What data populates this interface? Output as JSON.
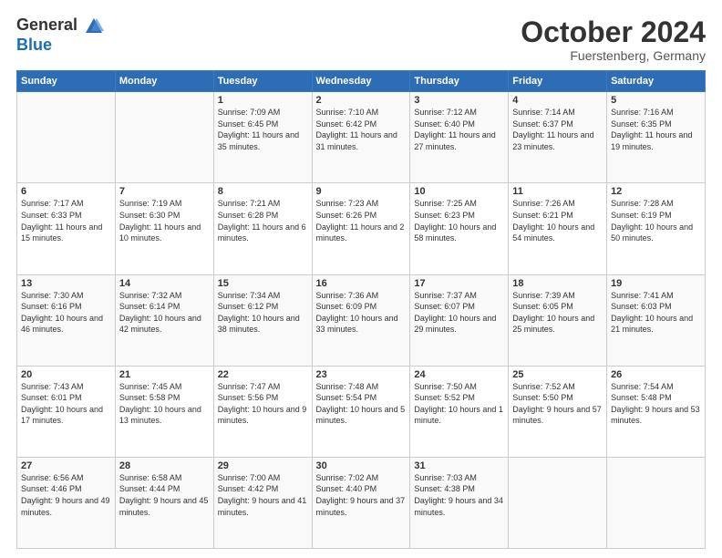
{
  "logo": {
    "general": "General",
    "blue": "Blue"
  },
  "header": {
    "title": "October 2024",
    "subtitle": "Fuerstenberg, Germany"
  },
  "weekdays": [
    "Sunday",
    "Monday",
    "Tuesday",
    "Wednesday",
    "Thursday",
    "Friday",
    "Saturday"
  ],
  "weeks": [
    [
      {
        "day": "",
        "sunrise": "",
        "sunset": "",
        "daylight": ""
      },
      {
        "day": "",
        "sunrise": "",
        "sunset": "",
        "daylight": ""
      },
      {
        "day": "1",
        "sunrise": "Sunrise: 7:09 AM",
        "sunset": "Sunset: 6:45 PM",
        "daylight": "Daylight: 11 hours and 35 minutes."
      },
      {
        "day": "2",
        "sunrise": "Sunrise: 7:10 AM",
        "sunset": "Sunset: 6:42 PM",
        "daylight": "Daylight: 11 hours and 31 minutes."
      },
      {
        "day": "3",
        "sunrise": "Sunrise: 7:12 AM",
        "sunset": "Sunset: 6:40 PM",
        "daylight": "Daylight: 11 hours and 27 minutes."
      },
      {
        "day": "4",
        "sunrise": "Sunrise: 7:14 AM",
        "sunset": "Sunset: 6:37 PM",
        "daylight": "Daylight: 11 hours and 23 minutes."
      },
      {
        "day": "5",
        "sunrise": "Sunrise: 7:16 AM",
        "sunset": "Sunset: 6:35 PM",
        "daylight": "Daylight: 11 hours and 19 minutes."
      }
    ],
    [
      {
        "day": "6",
        "sunrise": "Sunrise: 7:17 AM",
        "sunset": "Sunset: 6:33 PM",
        "daylight": "Daylight: 11 hours and 15 minutes."
      },
      {
        "day": "7",
        "sunrise": "Sunrise: 7:19 AM",
        "sunset": "Sunset: 6:30 PM",
        "daylight": "Daylight: 11 hours and 10 minutes."
      },
      {
        "day": "8",
        "sunrise": "Sunrise: 7:21 AM",
        "sunset": "Sunset: 6:28 PM",
        "daylight": "Daylight: 11 hours and 6 minutes."
      },
      {
        "day": "9",
        "sunrise": "Sunrise: 7:23 AM",
        "sunset": "Sunset: 6:26 PM",
        "daylight": "Daylight: 11 hours and 2 minutes."
      },
      {
        "day": "10",
        "sunrise": "Sunrise: 7:25 AM",
        "sunset": "Sunset: 6:23 PM",
        "daylight": "Daylight: 10 hours and 58 minutes."
      },
      {
        "day": "11",
        "sunrise": "Sunrise: 7:26 AM",
        "sunset": "Sunset: 6:21 PM",
        "daylight": "Daylight: 10 hours and 54 minutes."
      },
      {
        "day": "12",
        "sunrise": "Sunrise: 7:28 AM",
        "sunset": "Sunset: 6:19 PM",
        "daylight": "Daylight: 10 hours and 50 minutes."
      }
    ],
    [
      {
        "day": "13",
        "sunrise": "Sunrise: 7:30 AM",
        "sunset": "Sunset: 6:16 PM",
        "daylight": "Daylight: 10 hours and 46 minutes."
      },
      {
        "day": "14",
        "sunrise": "Sunrise: 7:32 AM",
        "sunset": "Sunset: 6:14 PM",
        "daylight": "Daylight: 10 hours and 42 minutes."
      },
      {
        "day": "15",
        "sunrise": "Sunrise: 7:34 AM",
        "sunset": "Sunset: 6:12 PM",
        "daylight": "Daylight: 10 hours and 38 minutes."
      },
      {
        "day": "16",
        "sunrise": "Sunrise: 7:36 AM",
        "sunset": "Sunset: 6:09 PM",
        "daylight": "Daylight: 10 hours and 33 minutes."
      },
      {
        "day": "17",
        "sunrise": "Sunrise: 7:37 AM",
        "sunset": "Sunset: 6:07 PM",
        "daylight": "Daylight: 10 hours and 29 minutes."
      },
      {
        "day": "18",
        "sunrise": "Sunrise: 7:39 AM",
        "sunset": "Sunset: 6:05 PM",
        "daylight": "Daylight: 10 hours and 25 minutes."
      },
      {
        "day": "19",
        "sunrise": "Sunrise: 7:41 AM",
        "sunset": "Sunset: 6:03 PM",
        "daylight": "Daylight: 10 hours and 21 minutes."
      }
    ],
    [
      {
        "day": "20",
        "sunrise": "Sunrise: 7:43 AM",
        "sunset": "Sunset: 6:01 PM",
        "daylight": "Daylight: 10 hours and 17 minutes."
      },
      {
        "day": "21",
        "sunrise": "Sunrise: 7:45 AM",
        "sunset": "Sunset: 5:58 PM",
        "daylight": "Daylight: 10 hours and 13 minutes."
      },
      {
        "day": "22",
        "sunrise": "Sunrise: 7:47 AM",
        "sunset": "Sunset: 5:56 PM",
        "daylight": "Daylight: 10 hours and 9 minutes."
      },
      {
        "day": "23",
        "sunrise": "Sunrise: 7:48 AM",
        "sunset": "Sunset: 5:54 PM",
        "daylight": "Daylight: 10 hours and 5 minutes."
      },
      {
        "day": "24",
        "sunrise": "Sunrise: 7:50 AM",
        "sunset": "Sunset: 5:52 PM",
        "daylight": "Daylight: 10 hours and 1 minute."
      },
      {
        "day": "25",
        "sunrise": "Sunrise: 7:52 AM",
        "sunset": "Sunset: 5:50 PM",
        "daylight": "Daylight: 9 hours and 57 minutes."
      },
      {
        "day": "26",
        "sunrise": "Sunrise: 7:54 AM",
        "sunset": "Sunset: 5:48 PM",
        "daylight": "Daylight: 9 hours and 53 minutes."
      }
    ],
    [
      {
        "day": "27",
        "sunrise": "Sunrise: 6:56 AM",
        "sunset": "Sunset: 4:46 PM",
        "daylight": "Daylight: 9 hours and 49 minutes."
      },
      {
        "day": "28",
        "sunrise": "Sunrise: 6:58 AM",
        "sunset": "Sunset: 4:44 PM",
        "daylight": "Daylight: 9 hours and 45 minutes."
      },
      {
        "day": "29",
        "sunrise": "Sunrise: 7:00 AM",
        "sunset": "Sunset: 4:42 PM",
        "daylight": "Daylight: 9 hours and 41 minutes."
      },
      {
        "day": "30",
        "sunrise": "Sunrise: 7:02 AM",
        "sunset": "Sunset: 4:40 PM",
        "daylight": "Daylight: 9 hours and 37 minutes."
      },
      {
        "day": "31",
        "sunrise": "Sunrise: 7:03 AM",
        "sunset": "Sunset: 4:38 PM",
        "daylight": "Daylight: 9 hours and 34 minutes."
      },
      {
        "day": "",
        "sunrise": "",
        "sunset": "",
        "daylight": ""
      },
      {
        "day": "",
        "sunrise": "",
        "sunset": "",
        "daylight": ""
      }
    ]
  ]
}
